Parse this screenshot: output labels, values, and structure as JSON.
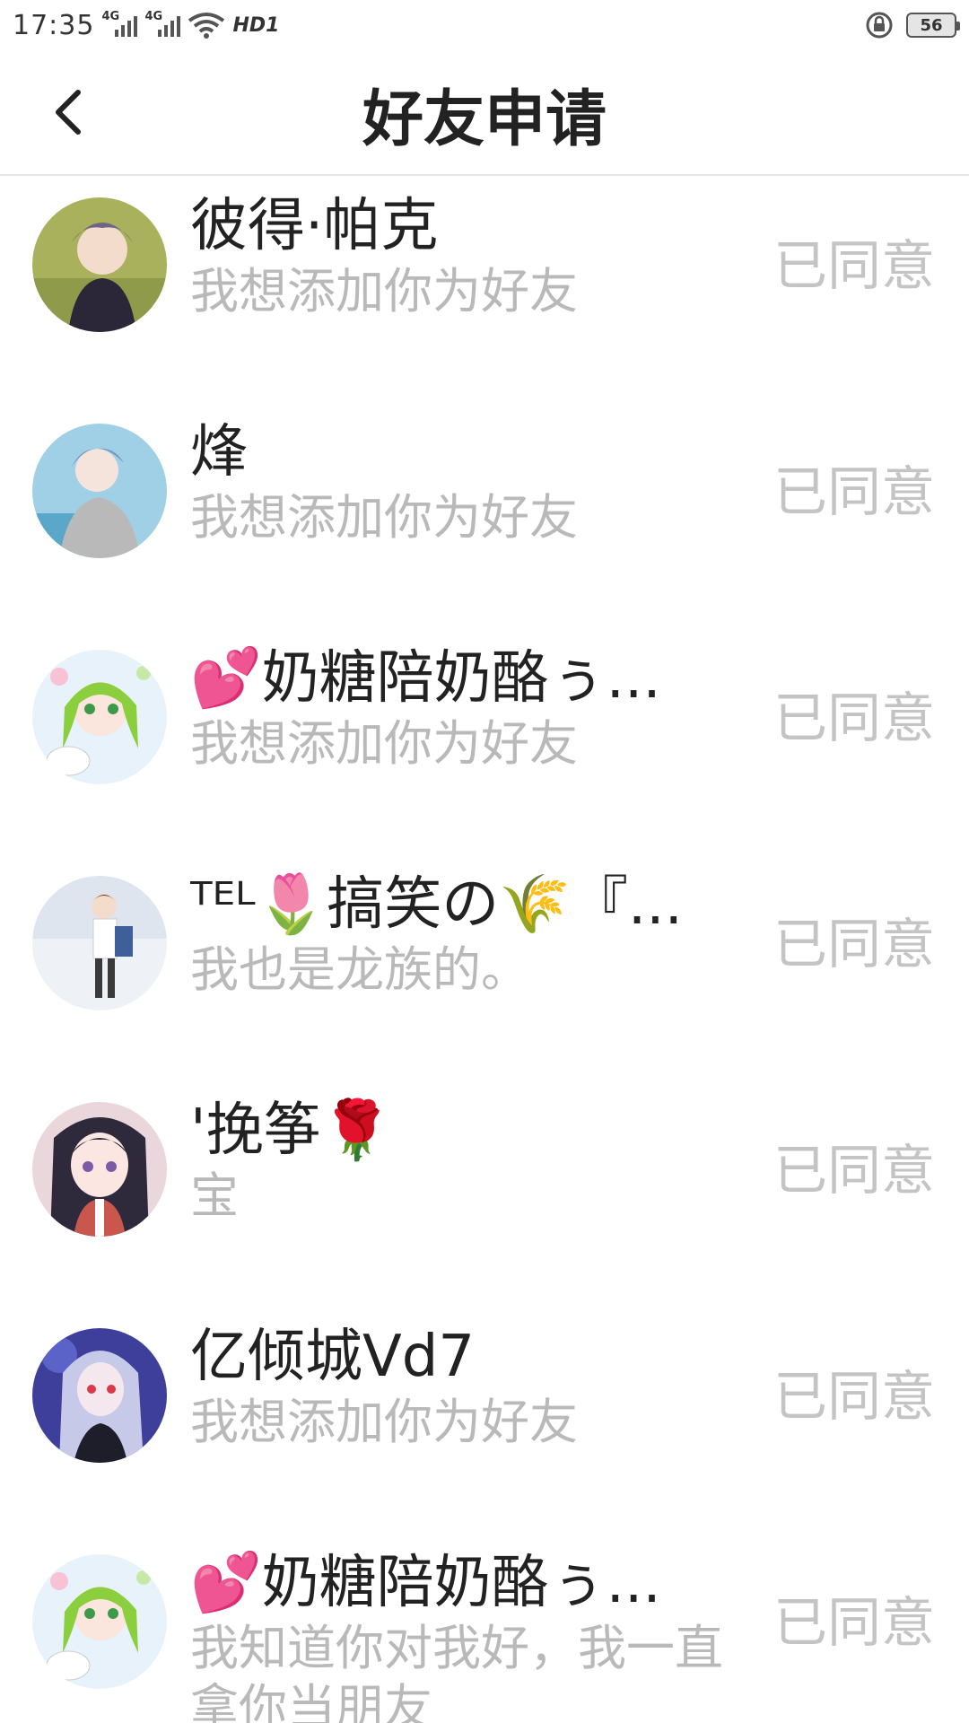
{
  "status_bar": {
    "time": "17:35",
    "signal_1": "4G",
    "signal_2": "4G",
    "network": "HD1",
    "battery": "56"
  },
  "header": {
    "title": "好友申请",
    "back_icon": "chevron-left-icon"
  },
  "requests": [
    {
      "name": "彼得·帕克",
      "message": "我想添加你为好友",
      "status": "已同意"
    },
    {
      "name": "烽",
      "message": "我想添加你为好友",
      "status": "已同意"
    },
    {
      "name": "💕奶糖陪奶酪ぅ...",
      "message": "我想添加你为好友",
      "status": "已同意"
    },
    {
      "name": "ᵀᴱᴸ🌷搞笑の🌾『...",
      "message": "我也是龙族的。",
      "status": "已同意"
    },
    {
      "name": "'挽筝🌹",
      "message": "宝",
      "status": "已同意"
    },
    {
      "name": "亿倾城Vd7",
      "message": "我想添加你为好友",
      "status": "已同意"
    },
    {
      "name": "💕奶糖陪奶酪ぅ...",
      "message": "我知道你对我好，我一直拿你当朋友",
      "status": "已同意"
    }
  ],
  "colors": {
    "title": "#222222",
    "message": "#b9b9b9",
    "status": "#c4c4c4",
    "divider": "#e6e6e6"
  }
}
